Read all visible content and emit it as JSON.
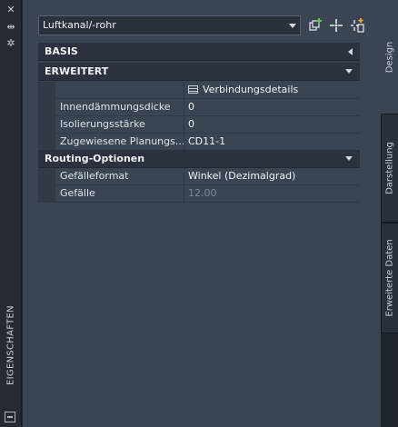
{
  "palette": {
    "titlebar_bg": "#262b33",
    "panel_bg": "#3b4453",
    "section_bg": "#2b323d",
    "text": "#e6e9ee",
    "disabled_text": "#7d8694"
  },
  "titlebar": {
    "title": "EIGENSCHAFTEN",
    "buttons": [
      "close-icon",
      "autohide-icon",
      "settings-icon"
    ]
  },
  "toolbar": {
    "object_select": "Luftkanal/-rohr",
    "icons": [
      "add-to-selection-icon",
      "quick-select-icon",
      "toggle-pickadd-icon"
    ]
  },
  "sections": {
    "basis": "BASIS",
    "erweitert": "ERWEITERT",
    "routing": "Routing-Optionen"
  },
  "erweitert_rows": [
    {
      "name": "",
      "value": "Verbindungsdetails"
    },
    {
      "name": "Innendämmungsdicke",
      "value": "0"
    },
    {
      "name": "Isolierungsstärke",
      "value": "0"
    },
    {
      "name": "Zugewiesene Planungs...",
      "value": "CD11-1"
    }
  ],
  "routing_rows": [
    {
      "name": "Gefälleformat",
      "value": "Winkel (Dezimalgrad)"
    },
    {
      "name": "Gefälle",
      "value": "12.00"
    }
  ],
  "tabs": [
    "Design",
    "Darstellung",
    "Erweiterte Daten"
  ]
}
